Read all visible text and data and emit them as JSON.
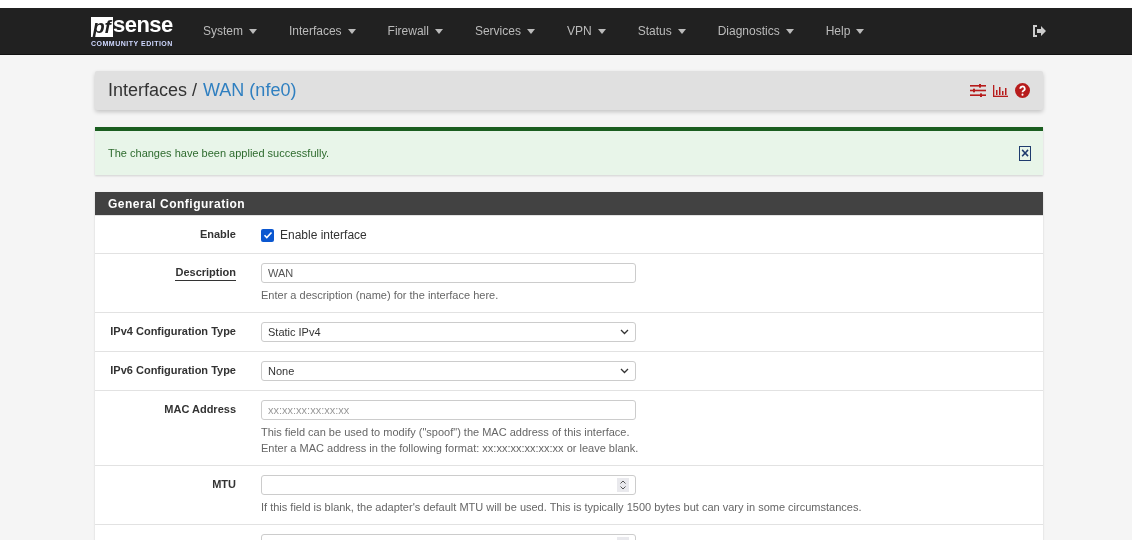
{
  "navbar": {
    "logo": {
      "mark": "pf",
      "word": "sense",
      "edition": "COMMUNITY EDITION"
    },
    "menu": [
      {
        "label": "System"
      },
      {
        "label": "Interfaces"
      },
      {
        "label": "Firewall"
      },
      {
        "label": "Services"
      },
      {
        "label": "VPN"
      },
      {
        "label": "Status"
      },
      {
        "label": "Diagnostics"
      },
      {
        "label": "Help"
      }
    ]
  },
  "breadcrumb": {
    "parent": "Interfaces /",
    "current": "WAN (nfe0)"
  },
  "alert": {
    "message": "The changes have been applied successfully.",
    "close": "×"
  },
  "panel": {
    "title": "General Configuration",
    "rows": [
      {
        "kind": "checkbox",
        "label": "Enable",
        "checked": true,
        "text": "Enable interface"
      },
      {
        "kind": "text",
        "label": "Description",
        "underlined": true,
        "value": "WAN",
        "help": [
          "Enter a description (name) for the interface here."
        ]
      },
      {
        "kind": "select",
        "label": "IPv4 Configuration Type",
        "value": "Static IPv4"
      },
      {
        "kind": "select",
        "label": "IPv6 Configuration Type",
        "value": "None"
      },
      {
        "kind": "text",
        "label": "MAC Address",
        "placeholder": "xx:xx:xx:xx:xx:xx",
        "help": [
          "This field can be used to modify (\"spoof\") the MAC address of this interface.",
          "Enter a MAC address in the following format: xx:xx:xx:xx:xx:xx or leave blank."
        ]
      },
      {
        "kind": "number",
        "label": "MTU",
        "help": [
          "If this field is blank, the adapter's default MTU will be used. This is typically 1500 bytes but can vary in some circumstances."
        ]
      },
      {
        "kind": "number"
      }
    ]
  }
}
